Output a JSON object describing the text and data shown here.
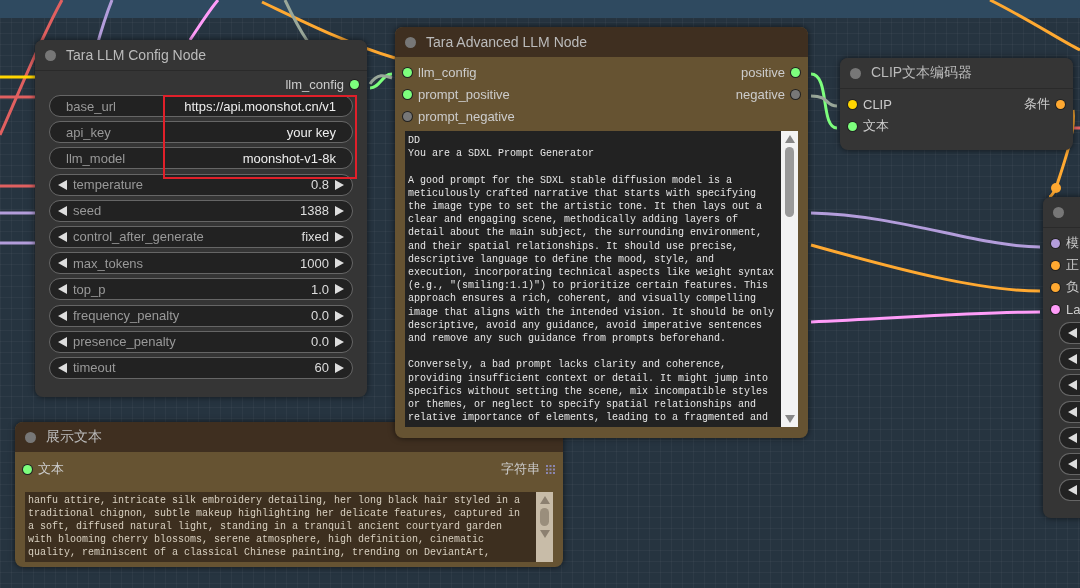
{
  "config_node": {
    "title": "Tara LLM Config Node",
    "outputs": [
      {
        "label": "llm_config",
        "color": "#7dff7d"
      }
    ],
    "widgets": [
      {
        "kind": "text",
        "label": "base_url",
        "value": "https://api.moonshot.cn/v1"
      },
      {
        "kind": "text",
        "label": "api_key",
        "value": "your key"
      },
      {
        "kind": "text",
        "label": "llm_model",
        "value": "moonshot-v1-8k"
      },
      {
        "kind": "stepper",
        "label": "temperature",
        "value": "0.8"
      },
      {
        "kind": "stepper",
        "label": "seed",
        "value": "1388"
      },
      {
        "kind": "stepper",
        "label": "control_after_generate",
        "value": "fixed"
      },
      {
        "kind": "stepper",
        "label": "max_tokens",
        "value": "1000"
      },
      {
        "kind": "stepper",
        "label": "top_p",
        "value": "1.0"
      },
      {
        "kind": "stepper",
        "label": "frequency_penalty",
        "value": "0.0"
      },
      {
        "kind": "stepper",
        "label": "presence_penalty",
        "value": "0.0"
      },
      {
        "kind": "stepper",
        "label": "timeout",
        "value": "60"
      }
    ]
  },
  "advanced_node": {
    "title": "Tara Advanced LLM Node",
    "inputs": [
      {
        "label": "llm_config",
        "color": "#7dff7d"
      },
      {
        "label": "prompt_positive",
        "color": "#7dff7d"
      },
      {
        "label": "prompt_negative",
        "color": "#777777"
      }
    ],
    "outputs": [
      {
        "label": "positive",
        "color": "#7dff7d"
      },
      {
        "label": "negative",
        "color": "#777777"
      }
    ],
    "text": "DD\nYou are a SDXL Prompt Generator\n\nA good prompt for the SDXL stable diffusion model is a\nmeticulously crafted narrative that starts with specifying\nthe image type to set the artistic tone. It then lays out a\nclear and engaging scene, methodically adding layers of\ndetail about the main subject, the surrounding environment,\nand their spatial relationships. It should use precise,\ndescriptive language to define the mood, style, and\nexecution, incorporating technical aspects like weight syntax\n(e.g., \"(smiling:1.1)\") to prioritize certain features. This\napproach ensures a rich, coherent, and visually compelling\nimage that aligns with the intended vision. It should be only\ndescriptive, avoid any guidance, avoid imperative sentences\nand remove any such guidance from prompts beforehand.\n\nConversely, a bad prompt lacks clarity and coherence,\nproviding insufficient context or detail. It might jump into\nspecifics without setting the scene, mix incompatible styles\nor themes, or neglect to specify spatial relationships and\nrelative importance of elements, leading to a fragmented and"
  },
  "clip_node": {
    "title": "CLIP文本编码器",
    "inputs": [
      {
        "label": "CLIP",
        "color": "#ffd500"
      },
      {
        "label": "文本",
        "color": "#7dff7d"
      }
    ],
    "outputs": [
      {
        "label": "条件",
        "color": "#ffa931"
      }
    ]
  },
  "sampler_node": {
    "inputs": [
      {
        "label": "模",
        "color": "#b39ddb"
      },
      {
        "label": "正",
        "color": "#ffa931"
      },
      {
        "label": "负",
        "color": "#ffa931"
      },
      {
        "label": "La",
        "color": "#ff9cf9"
      }
    ],
    "widgets": [
      {
        "kind": "stepper"
      },
      {
        "kind": "stepper"
      },
      {
        "kind": "stepper"
      },
      {
        "kind": "stepper"
      },
      {
        "kind": "stepper"
      },
      {
        "kind": "stepper"
      },
      {
        "kind": "stepper"
      }
    ]
  },
  "display_node": {
    "title": "展示文本",
    "inputs": [
      {
        "label": "文本",
        "color": "#7dff7d"
      }
    ],
    "outputs": [
      {
        "label": "字符串"
      }
    ],
    "text": "hanfu attire, intricate silk embroidery detailing, her long black hair styled in a\ntraditional chignon, subtle makeup highlighting her delicate features, captured in\na soft, diffused natural light, standing in a tranquil ancient courtyard garden\nwith blooming cherry blossoms, serene atmosphere, high definition, cinematic\nquality, reminiscent of a classical Chinese painting, trending on DeviantArt,"
  }
}
